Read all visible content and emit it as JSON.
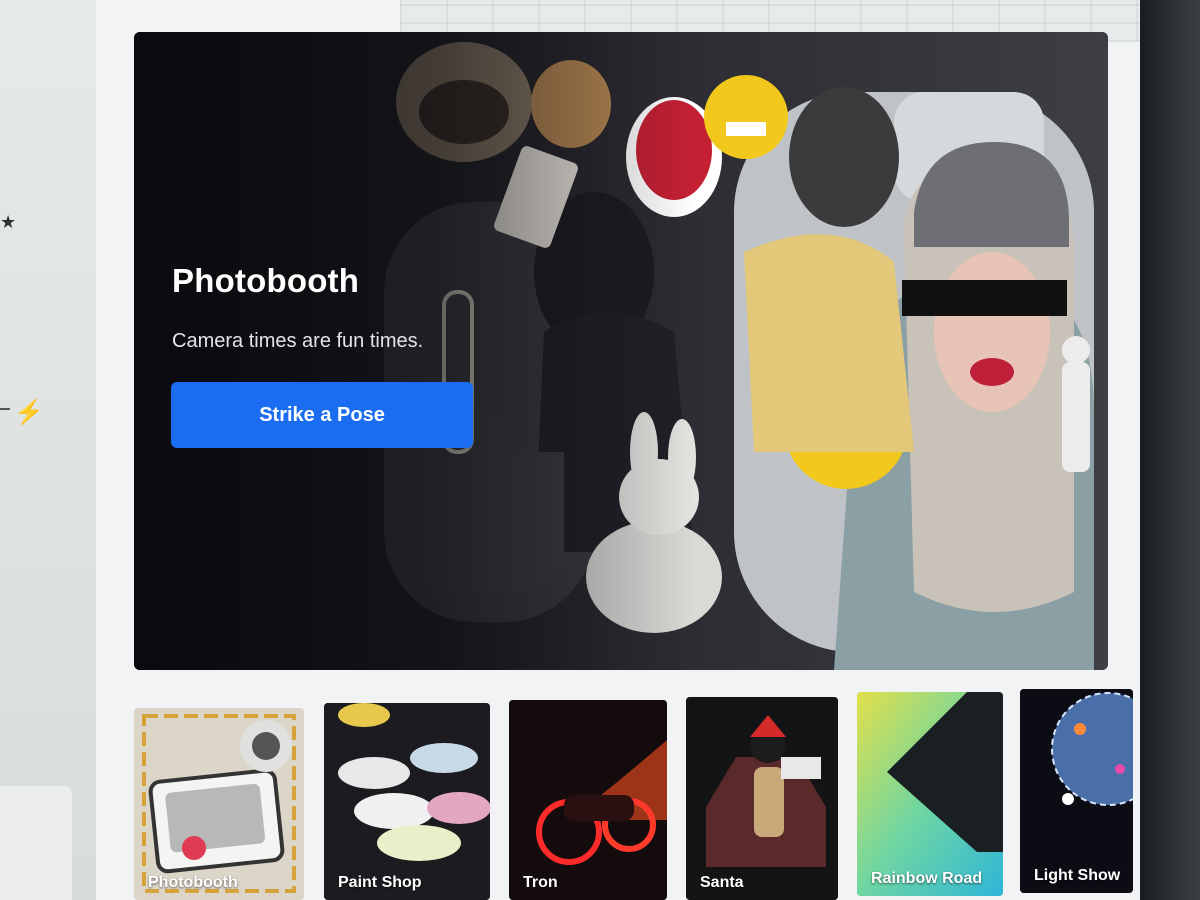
{
  "hero": {
    "title": "Photobooth",
    "subtitle": "Camera times are fun times.",
    "cta_label": "Strike a Pose"
  },
  "cards": [
    {
      "label": "Photobooth"
    },
    {
      "label": "Paint Shop"
    },
    {
      "label": "Tron"
    },
    {
      "label": "Santa"
    },
    {
      "label": "Rainbow Road"
    },
    {
      "label": "Light Show"
    }
  ],
  "colors": {
    "accent": "#1a6cf0",
    "hero_bg": "#121217",
    "panel_bg": "#f1f3f4"
  },
  "icons": {
    "left_nav": [
      "star-icon",
      "bolt-icon"
    ]
  }
}
